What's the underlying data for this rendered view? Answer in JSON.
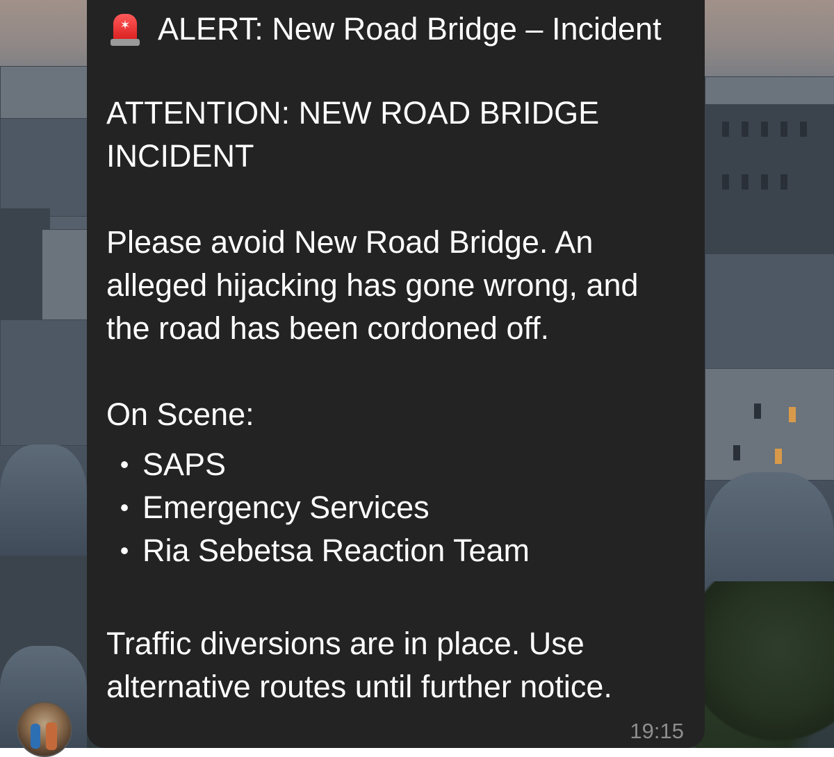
{
  "message": {
    "title": "ALERT: New Road Bridge – Incident",
    "heading_line1": "ATTENTION: NEW ROAD BRIDGE",
    "heading_line2": "INCIDENT",
    "body_line1": "Please avoid New Road Bridge. An",
    "body_line2": "alleged hijacking has gone wrong, and",
    "body_line3": "the road has been cordoned off.",
    "on_scene_label": "On Scene:",
    "on_scene_items": [
      "SAPS",
      "Emergency Services",
      "Ria Sebetsa Reaction Team"
    ],
    "footer_line1": "Traffic diversions are in place. Use",
    "footer_line2": "alternative routes until further notice.",
    "timestamp": "19:15",
    "bullet_glyph": "•"
  },
  "icons": {
    "alert": "police-siren-icon",
    "sender": "sender-avatar"
  },
  "colors": {
    "bubble_background": "#232323",
    "text": "#ffffff",
    "timestamp": "#8e8e8e",
    "siren_red": "#e02424"
  }
}
